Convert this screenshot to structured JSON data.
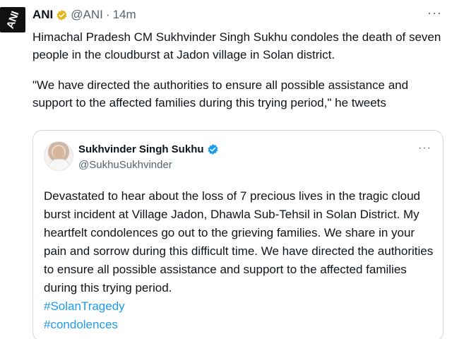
{
  "tweet": {
    "author": {
      "name": "ANI",
      "handle": "@ANI",
      "avatar_text": "ANI",
      "verified_color": "#e2b719"
    },
    "separator": "·",
    "time": "14m",
    "text_p1": "Himachal Pradesh CM Sukhvinder Singh Sukhu condoles the death of seven people in the cloudburst at Jadon village in Solan district.",
    "text_p2": "\"We have directed the authorities to ensure all possible assistance and support to the affected families during this trying period,\" he tweets",
    "more_label": "···"
  },
  "quote": {
    "author": {
      "name": "Sukhvinder Singh Sukhu",
      "handle": "@SukhuSukhvinder",
      "verified_color": "#1d9bf0"
    },
    "more_label": "···",
    "text": "Devastated to hear about the loss of 7 precious lives in the tragic cloud burst incident at Village Jadon, Dhawla Sub-Tehsil in Solan District. My heartfelt condolences go out to the grieving families. We share in your pain and sorrow during this difficult time. We have directed the authorities to ensure all possible assistance and support to the affected families during this trying period.",
    "hashtags": [
      "#SolanTragedy",
      "#condolences"
    ]
  }
}
